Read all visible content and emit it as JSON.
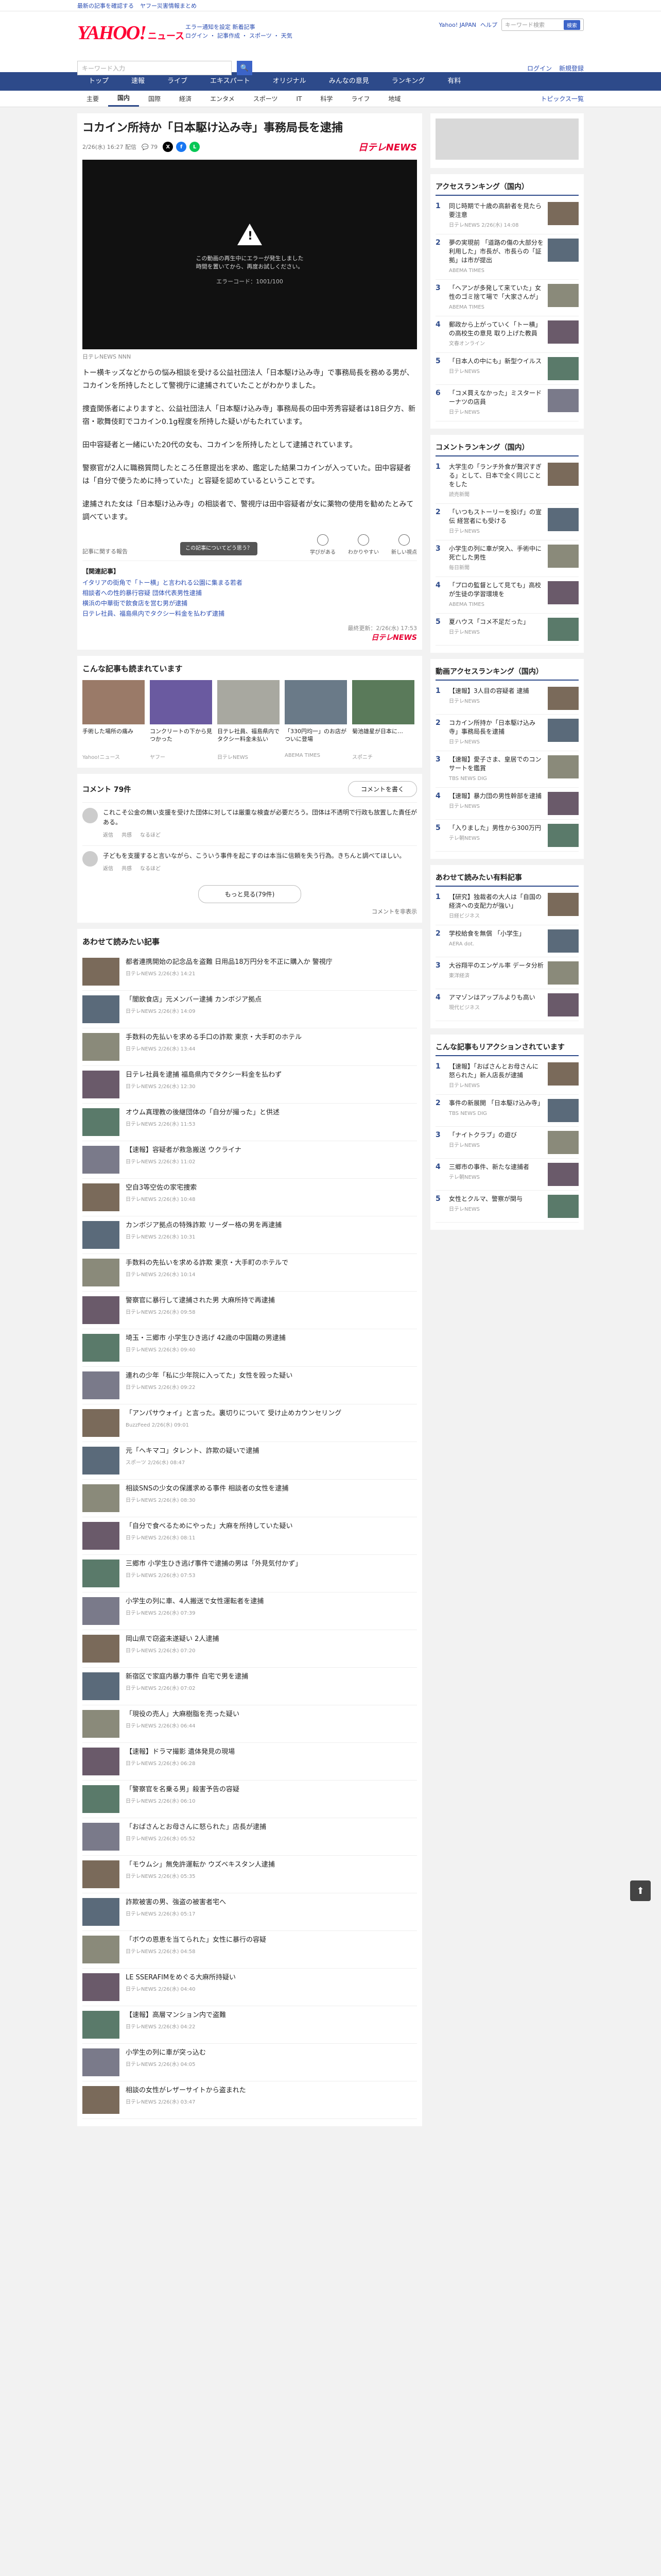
{
  "topbar": {
    "items": [
      "最新の記事を確認する",
      "ヤフー災害情報まとめ"
    ]
  },
  "header": {
    "logo": "YAHOO!",
    "logo_sub": "ニュース",
    "info_line1": "エラー通知を設定 新着記事",
    "info_line2": "ログイン ・ 記事作成 ・ スポーツ ・ 天気",
    "right_links": [
      "Yahoo! JAPAN",
      "ヘルプ"
    ],
    "top_search_placeholder": "キーワード検索",
    "top_search_button": "検索"
  },
  "search": {
    "placeholder": "キーワード入力",
    "links": [
      "ログイン",
      "新規登録"
    ]
  },
  "nav": [
    "トップ",
    "速報",
    "ライブ",
    "エキスパート",
    "オリジナル",
    "みんなの意見",
    "ランキング",
    "有料"
  ],
  "subnav": [
    "主要",
    "国内",
    "国際",
    "経済",
    "エンタメ",
    "スポーツ",
    "IT",
    "科学",
    "ライフ",
    "地域"
  ],
  "subnav_right": "トピックス一覧",
  "article": {
    "title": "コカイン所持か「日本駆け込み寺」事務局長を逮捕",
    "date": "2/26(水) 16:27 配信",
    "comments_count": "79",
    "source": "日テレNEWS",
    "video": {
      "msg1": "この動画の再生中にエラーが発生しました",
      "msg2": "時間を置いてから、再度お試しください。",
      "err": "エラーコード：1001/100"
    },
    "caption": "日テレNEWS NNN",
    "paragraphs": [
      "トー横キッズなどからの悩み相談を受ける公益社団法人「日本駆け込み寺」で事務局長を務める男が、コカインを所持したとして警視庁に逮捕されていたことがわかりました。",
      "捜査関係者によりますと、公益社団法人「日本駆け込み寺」事務局長の田中芳秀容疑者は18日夕方、新宿・歌舞伎町でコカイン0.1g程度を所持した疑いがもたれています。",
      "田中容疑者と一緒にいた20代の女も、コカインを所持したとして逮捕されています。",
      "警察官が2人に職務質問したところ任意提出を求め、鑑定した結果コカインが入っていた。田中容疑者は「自分で使うために持っていた」と容疑を認めているということです。",
      "逮捕された女は「日本駆け込み寺」の相談者で、警視庁は田中容疑者が女に薬物の使用を勧めたとみて調べています。"
    ],
    "reaction_prompt": "この記事についてどう思う？",
    "reaction_hint": "記事に関する報告",
    "reactions": [
      "学びがある",
      "わかりやすい",
      "新しい視点"
    ],
    "related_heading": "【関連記事】",
    "related": [
      "イタリアの街角で「トー横」と言われる公園に集まる若者",
      "相談者への性的暴行容疑 団体代表男性逮捕",
      "横浜の中華街で飲食店を営む男が逮捕",
      "日テレ社員、福島県内でタクシー料金を払わず逮捕"
    ],
    "source_line": "最終更新：2/26(水) 17:53"
  },
  "also_read": {
    "title": "こんな記事も読まれています",
    "items": [
      {
        "t": "手術した場所の痛み",
        "s": "Yahoo!ニュース"
      },
      {
        "t": "コンクリートの下から見つかった",
        "s": "ヤフー"
      },
      {
        "t": "日テレ社員、福島県内でタクシー料金未払い",
        "s": "日テレNEWS"
      },
      {
        "t": "「330円均一」のお店がついに登場",
        "s": "ABEMA TIMES"
      },
      {
        "t": "菊池雄星が日本に…",
        "s": "スポニチ"
      }
    ]
  },
  "comments": {
    "label": "コメント",
    "count": "79件",
    "button": "コメントを書く",
    "items": [
      {
        "text": "これこそ公金の無い支援を受けた団体に対しては厳重な検査が必要だろう。団体は不透明で行政も放置した責任がある。",
        "meta": [
          "返信",
          "共感",
          "なるほど"
        ]
      },
      {
        "text": "子どもを支援すると言いながら、こういう事件を起こすのは本当に信頼を失う行為。きちんと調べてほしい。",
        "meta": [
          "返信",
          "共感",
          "なるほど"
        ]
      }
    ],
    "more": "もっと見る(79件)",
    "hide": "コメントを非表示"
  },
  "recommend": {
    "title": "あわせて読みたい記事",
    "items": [
      {
        "t": "都者連携開始の記念品を盗難 日用品18万円分を不正に購入か 警視庁",
        "s": "日テレNEWS 2/26(水) 14:21"
      },
      {
        "t": "「闇飲食店」元メンバー逮捕 カンボジア拠点",
        "s": "日テレNEWS 2/26(水) 14:09"
      },
      {
        "t": "手数料の先払いを求める手口の詐欺 東京・大手町のホテル",
        "s": "日テレNEWS 2/26(水) 13:44"
      },
      {
        "t": "日テレ社員を逮捕 福島県内でタクシー料金を払わず",
        "s": "日テレNEWS 2/26(水) 12:30"
      },
      {
        "t": "オウム真理教の後継団体の「自分が撮った」と供述",
        "s": "日テレNEWS 2/26(水) 11:53"
      },
      {
        "t": "【速報】容疑者が救急搬送 ウクライナ",
        "s": "日テレNEWS 2/26(水) 11:02"
      },
      {
        "t": "空自3等空佐の家宅捜索",
        "s": "日テレNEWS 2/26(水) 10:48"
      },
      {
        "t": "カンボジア拠点の特殊詐欺 リーダー格の男を再逮捕",
        "s": "日テレNEWS 2/26(水) 10:31"
      },
      {
        "t": "手数料の先払いを求める詐欺 東京・大手町のホテルで",
        "s": "日テレNEWS 2/26(水) 10:14"
      },
      {
        "t": "警察官に暴行して逮捕された男 大麻所持で再逮捕",
        "s": "日テレNEWS 2/26(水) 09:58"
      },
      {
        "t": "埼玉・三郷市 小学生ひき逃げ 42歳の中国籍の男逮捕",
        "s": "日テレNEWS 2/26(水) 09:40"
      },
      {
        "t": "連れの少年「私に少年院に入ってた」女性を殴った疑い",
        "s": "日テレNEWS 2/26(水) 09:22"
      },
      {
        "t": "「アンパサウォイ」と言った。裏切りについて 受け止めカウンセリング",
        "s": "BuzzFeed 2/26(水) 09:01"
      },
      {
        "t": "元「ヘキマコ」タレント、詐欺の疑いで逮捕",
        "s": "スポーツ 2/26(水) 08:47"
      },
      {
        "t": "相談SNSの少女の保護求める事件 相談者の女性を逮捕",
        "s": "日テレNEWS 2/26(水) 08:30"
      },
      {
        "t": "「自分で食べるためにやった」大麻を所持していた疑い",
        "s": "日テレNEWS 2/26(水) 08:11"
      },
      {
        "t": "三郷市 小学生ひき逃げ事件で逮捕の男は「外見気付かず」",
        "s": "日テレNEWS 2/26(水) 07:53"
      },
      {
        "t": "小学生の列に車、4人搬送で女性運転者を逮捕",
        "s": "日テレNEWS 2/26(水) 07:39"
      },
      {
        "t": "岡山県で窃盗未遂疑い 2人逮捕",
        "s": "日テレNEWS 2/26(水) 07:20"
      },
      {
        "t": "新宿区で家庭内暴力事件 自宅で男を逮捕",
        "s": "日テレNEWS 2/26(水) 07:02"
      },
      {
        "t": "「現役の売人」大麻樹脂を売った疑い",
        "s": "日テレNEWS 2/26(水) 06:44"
      },
      {
        "t": "【速報】ドラマ撮影 遺体発見の現場",
        "s": "日テレNEWS 2/26(水) 06:28"
      },
      {
        "t": "「警察官を名乗る男」殺害予告の容疑",
        "s": "日テレNEWS 2/26(水) 06:10"
      },
      {
        "t": "「おばさんとお母さんに怒られた」店長が逮捕",
        "s": "日テレNEWS 2/26(水) 05:52"
      },
      {
        "t": "「モウムシ」無免許運転か ウズベキスタン人逮捕",
        "s": "日テレNEWS 2/26(水) 05:35"
      },
      {
        "t": "詐欺被害の男、強盗の被害者宅へ",
        "s": "日テレNEWS 2/26(水) 05:17"
      },
      {
        "t": "「ボウの恩恵を当てられた」女性に暴行の容疑",
        "s": "日テレNEWS 2/26(水) 04:58"
      },
      {
        "t": "LE SSERAFIMをめぐる大麻所持疑い",
        "s": "日テレNEWS 2/26(水) 04:40"
      },
      {
        "t": "【速報】高層マンション内で盗難",
        "s": "日テレNEWS 2/26(水) 04:22"
      },
      {
        "t": "小学生の列に車が突っ込む",
        "s": "日テレNEWS 2/26(水) 04:05"
      },
      {
        "t": "相談の女性がレザーサイトから盗まれた",
        "s": "日テレNEWS 2/26(水) 03:47"
      }
    ]
  },
  "side": {
    "ranking_title": "アクセスランキング（国内）",
    "ranking": [
      {
        "t": "同じ時期で十歳の高齢者を見たら要注意",
        "s": "日テレNEWS 2/26(水) 14:08"
      },
      {
        "t": "夢の実現前 「道路の傷の大部分を利用した」市長が、市長らの「証拠」は市が提出",
        "s": "ABEMA TIMES"
      },
      {
        "t": "「ヘアンが多発して来ていた」女性のゴミ捨て場で「大家さんが」",
        "s": "ABEMA TIMES"
      },
      {
        "t": "郵政から上がっていく「トー横」の高校生の意見 取り上げた教員",
        "s": "文春オンライン"
      },
      {
        "t": "「日本人の中にも」新型ウイルス",
        "s": "日テレNEWS"
      },
      {
        "t": "「コメ買えなかった」ミスタードーナツの店員",
        "s": "日テレNEWS"
      }
    ],
    "comment_rank_title": "コメントランキング（国内）",
    "comment_rank": [
      {
        "t": "大学生の「ランチ外食が贅沢すぎる」として、日本で全く同じことをした",
        "s": "読売新聞"
      },
      {
        "t": "「いつもストーリーを投げ」の宣伝 経営者にも受ける",
        "s": "日テレNEWS"
      },
      {
        "t": "小学生の列に車が突入、手術中に死亡した男性",
        "s": "毎日新聞"
      },
      {
        "t": "「プロの監督として見ても」高校が生徒の学習環境を",
        "s": "ABEMA TIMES"
      },
      {
        "t": "夏ハウス「コメ不足だった」",
        "s": "日テレNEWS"
      }
    ],
    "video_rank_title": "動画アクセスランキング（国内）",
    "video_rank": [
      {
        "t": "【速報】3人目の容疑者 逮捕",
        "s": "日テレNEWS"
      },
      {
        "t": "コカイン所持か「日本駆け込み寺」事務局長を逮捕",
        "s": "日テレNEWS"
      },
      {
        "t": "【速報】愛子さま、皇居でのコンサートを鑑賞",
        "s": "TBS NEWS DIG"
      },
      {
        "t": "【速報】暴力団の男性幹部を逮捕",
        "s": "日テレNEWS"
      },
      {
        "t": "「入りました」男性から300万円",
        "s": "テレ朝NEWS"
      }
    ],
    "pickup_title": "あわせて読みたい有料記事",
    "pickup": [
      {
        "t": "【研究】独裁者の大人は「自国の経済への支配力が強い」",
        "s": "日経ビジネス"
      },
      {
        "t": "学校給食を無償 「小学生」",
        "s": "AERA dot."
      },
      {
        "t": "大谷翔平のエンゲル率 データ分析",
        "s": "東洋経済"
      },
      {
        "t": "アマゾンはアップルよりも高い",
        "s": "現代ビジネス"
      }
    ],
    "recommend_title": "こんな記事もリアクションされています",
    "recommend": [
      {
        "t": "【速報】「おばさんとお母さんに怒られた」新人店長が逮捕",
        "s": "日テレNEWS"
      },
      {
        "t": "事件の新展開 「日本駆け込み寺」",
        "s": "TBS NEWS DIG"
      },
      {
        "t": "「ナイトクラブ」の遊び",
        "s": "日テレNEWS"
      },
      {
        "t": "三郷市の事件、新たな逮捕者",
        "s": "テレ朝NEWS"
      },
      {
        "t": "女性とクルマ、警察が関与",
        "s": "日テレNEWS"
      }
    ]
  }
}
